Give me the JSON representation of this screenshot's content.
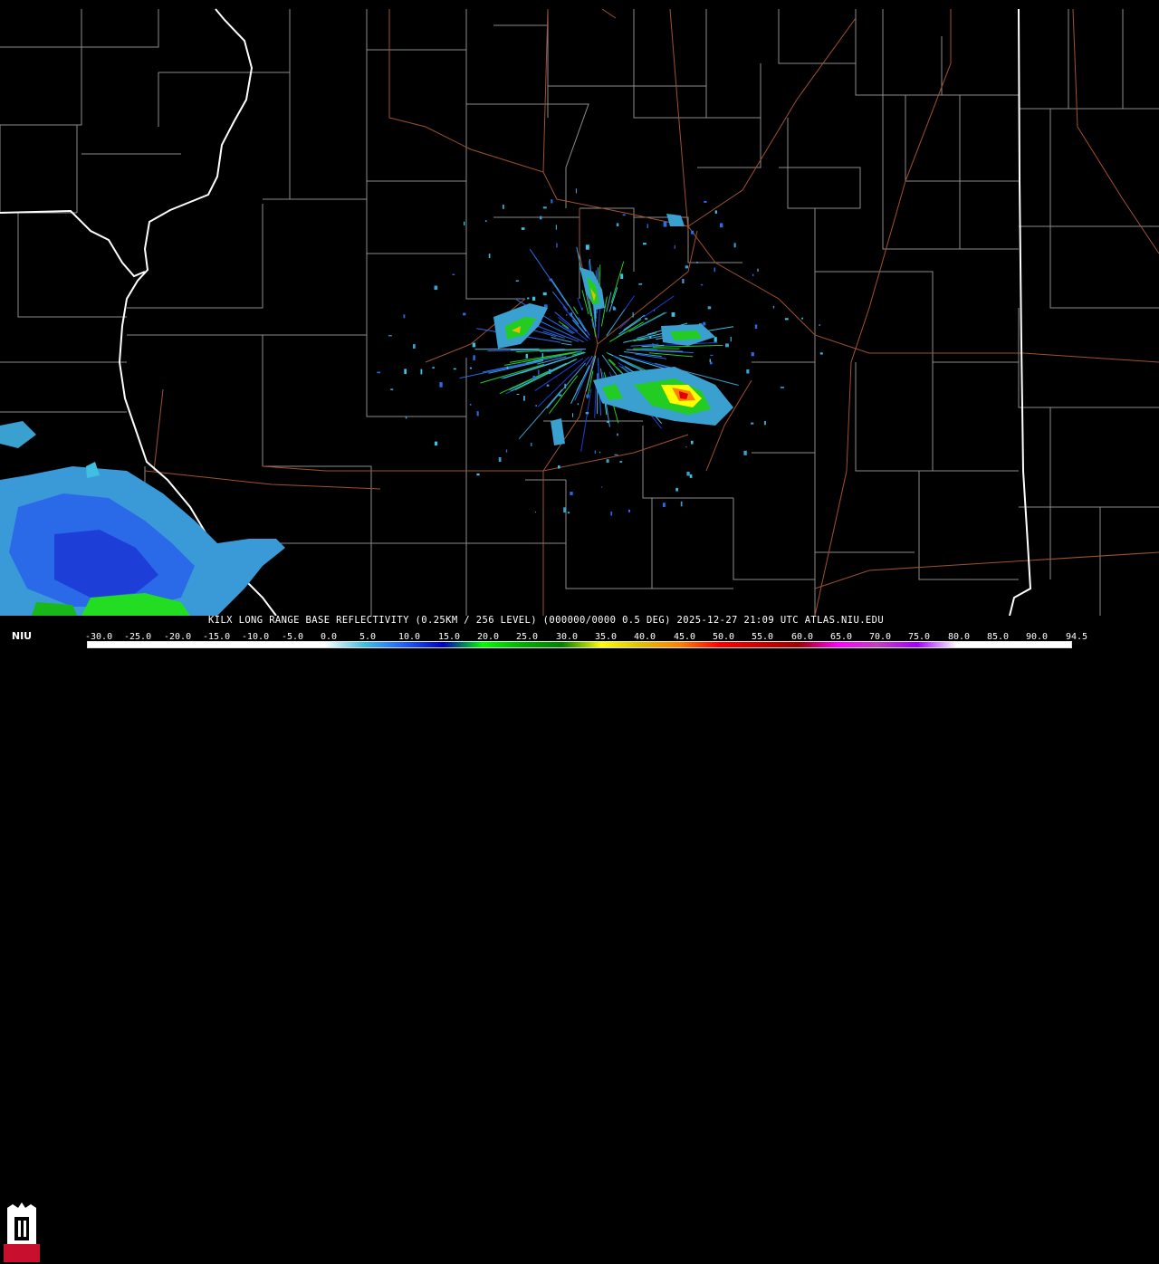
{
  "product": {
    "title": "KILX LONG RANGE BASE REFLECTIVITY (0.25KM / 256 LEVEL) (000000/0000 0.5 DEG) 2025-12-27 21:09 UTC  ATLAS.NIU.EDU"
  },
  "logo": {
    "text": "NIU",
    "color": "#c8102e"
  },
  "colors": {
    "background": "#000000",
    "county_border": "#8c8c8c",
    "state_border": "#ffffff",
    "highway": "#a0522d"
  },
  "scale": {
    "unit_min": -30.0,
    "unit_max": 94.5,
    "labels": [
      "-30.0",
      "-25.0",
      "-20.0",
      "-15.0",
      "-10.0",
      "-5.0",
      "0.0",
      "5.0",
      "10.0",
      "15.0",
      "20.0",
      "25.0",
      "30.0",
      "35.0",
      "40.0",
      "45.0",
      "50.0",
      "55.0",
      "60.0",
      "65.0",
      "70.0",
      "75.0",
      "80.0",
      "85.0",
      "90.0",
      "94.5"
    ],
    "stops": [
      {
        "value": -30,
        "color": "#ffffff"
      },
      {
        "value": 0,
        "color": "#ffffff"
      },
      {
        "value": 5,
        "color": "#40c0e0"
      },
      {
        "value": 10,
        "color": "#2060ff"
      },
      {
        "value": 15,
        "color": "#0000c0"
      },
      {
        "value": 20,
        "color": "#00ff00"
      },
      {
        "value": 25,
        "color": "#00b000"
      },
      {
        "value": 30,
        "color": "#008000"
      },
      {
        "value": 35,
        "color": "#ffff00"
      },
      {
        "value": 40,
        "color": "#e0c000"
      },
      {
        "value": 45,
        "color": "#ff8000"
      },
      {
        "value": 50,
        "color": "#ff0000"
      },
      {
        "value": 55,
        "color": "#d00000"
      },
      {
        "value": 60,
        "color": "#a00000"
      },
      {
        "value": 65,
        "color": "#ff00ff"
      },
      {
        "value": 70,
        "color": "#c040c0"
      },
      {
        "value": 75,
        "color": "#a000ff"
      },
      {
        "value": 80,
        "color": "#ffffff"
      },
      {
        "value": 94.5,
        "color": "#ffffff"
      }
    ]
  }
}
